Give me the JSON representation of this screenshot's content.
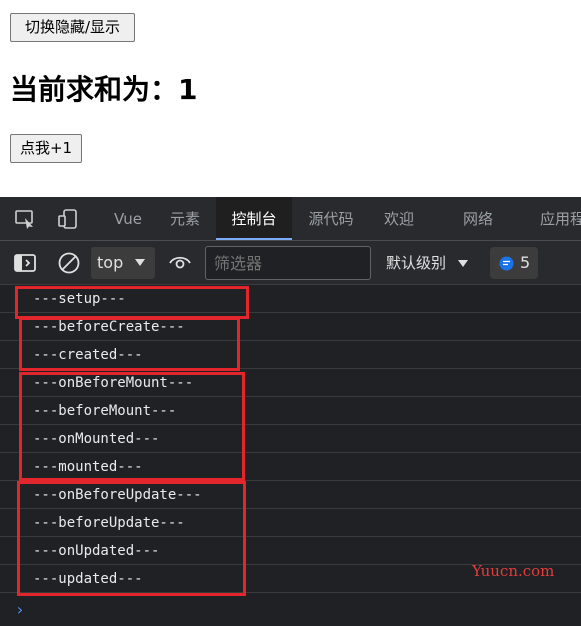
{
  "app": {
    "toggle_button": "切换隐藏/显示",
    "sum_text": "当前求和为：1",
    "increment_button": "点我+1"
  },
  "devtools": {
    "tabs": [
      {
        "label": "Vue",
        "active": false
      },
      {
        "label": "元素",
        "active": false
      },
      {
        "label": "控制台",
        "active": true
      },
      {
        "label": "源代码",
        "active": false
      },
      {
        "label": "欢迎",
        "active": false
      },
      {
        "label": "网络",
        "active": false
      },
      {
        "label": "应用程",
        "active": false
      }
    ],
    "toolbar": {
      "context": "top",
      "filter_placeholder": "筛选器",
      "level": "默认级别",
      "message_count": "5"
    },
    "logs": [
      "---setup---",
      "---beforeCreate---",
      "---created---",
      "---onBeforeMount---",
      "---beforeMount---",
      "---onMounted---",
      "---mounted---",
      "---onBeforeUpdate---",
      "---beforeUpdate---",
      "---onUpdated---",
      "---updated---"
    ],
    "prompt": "›"
  },
  "watermark": "Yuucn.com",
  "colors": {
    "highlight": "#e3262c",
    "active_tab_underline": "#7cacf8",
    "devtools_bg": "#202124",
    "message_badge": "#1a73e8"
  }
}
